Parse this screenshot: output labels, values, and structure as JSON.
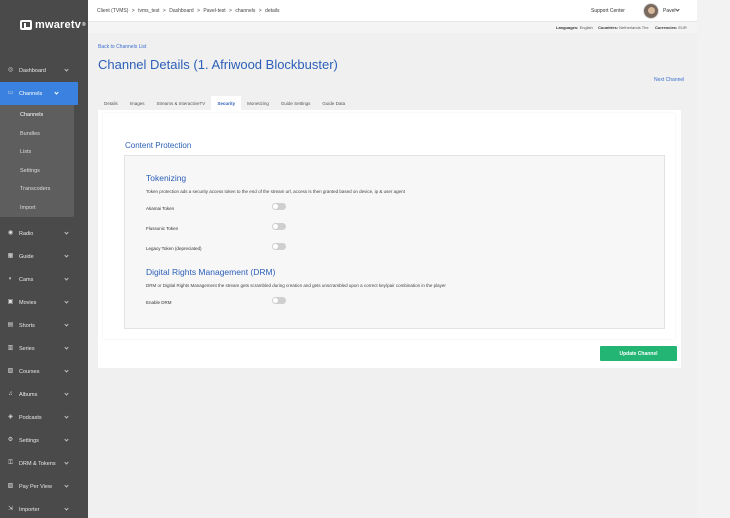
{
  "brand": {
    "name": "mwaretv",
    "tm": "®"
  },
  "sidebar": {
    "items": [
      {
        "label": "Dashboard",
        "icon": "◎"
      },
      {
        "label": "Channels",
        "icon": "▭",
        "active": true
      },
      {
        "label": "Radio",
        "icon": "◉"
      },
      {
        "label": "Guide",
        "icon": "▦"
      },
      {
        "label": "Cams",
        "icon": "◐"
      },
      {
        "label": "Movies",
        "icon": "▣"
      },
      {
        "label": "Shorts",
        "icon": "▤"
      },
      {
        "label": "Series",
        "icon": "▥"
      },
      {
        "label": "Courses",
        "icon": "▧"
      },
      {
        "label": "Albums",
        "icon": "♫"
      },
      {
        "label": "Podcasts",
        "icon": "◈"
      },
      {
        "label": "Settings",
        "icon": "⚙"
      },
      {
        "label": "DRM & Tokens",
        "icon": "⚿"
      },
      {
        "label": "Pay Per View",
        "icon": "▨"
      },
      {
        "label": "Importer",
        "icon": "⇲"
      }
    ],
    "subitems": [
      "Channels",
      "Bundles",
      "Lists",
      "Settings",
      "Transcoders",
      "Import"
    ]
  },
  "topbar": {
    "breadcrumb": [
      "Client (TVMS)",
      ">",
      "tvms_test",
      ">",
      "Dashboard",
      ">",
      "Pavel-test",
      ">",
      "channels",
      ">",
      "details"
    ],
    "support": "Support Center",
    "user": "Pavel"
  },
  "infobar": {
    "languages_label": "Languages:",
    "languages_value": "English",
    "countries_label": "Countries:",
    "countries_value": "Netherlands The",
    "currencies_label": "Currencies:",
    "currencies_value": "EUR"
  },
  "page": {
    "back": "Back to Channels List",
    "title": "Channel Details (1. Afriwood Blockbuster)",
    "next": "Next Channel"
  },
  "tabs": [
    "Details",
    "Images",
    "Streams & InteractiveTV",
    "Security",
    "Monetizing",
    "Guide Settings",
    "Guide Data"
  ],
  "active_tab": "Security",
  "content": {
    "section_title": "Content Protection",
    "tokenizing": {
      "title": "Tokenizing",
      "desc": "Token protection ads a security access token to the end of the stream url, access is then granted based on device, ip & user agent",
      "toggles": [
        {
          "label": "Akamai Token",
          "on": false
        },
        {
          "label": "Flussonic Token",
          "on": false
        },
        {
          "label": "Legacy Token (depreciated)",
          "on": false
        }
      ]
    },
    "drm": {
      "title": "Digital Rights Management (DRM)",
      "desc": "DRM or Digital Rights Management the stream gets scrambled during creation and gets unscrambled upon a correct key/pair combination in the player",
      "toggle_label": "Enable DRM",
      "on": false
    }
  },
  "update_button": "Update Channel",
  "colors": {
    "accent": "#2c5fb8",
    "active_nav": "#3b82e0",
    "button": "#22b573",
    "sidebar": "#4a4a4a"
  }
}
